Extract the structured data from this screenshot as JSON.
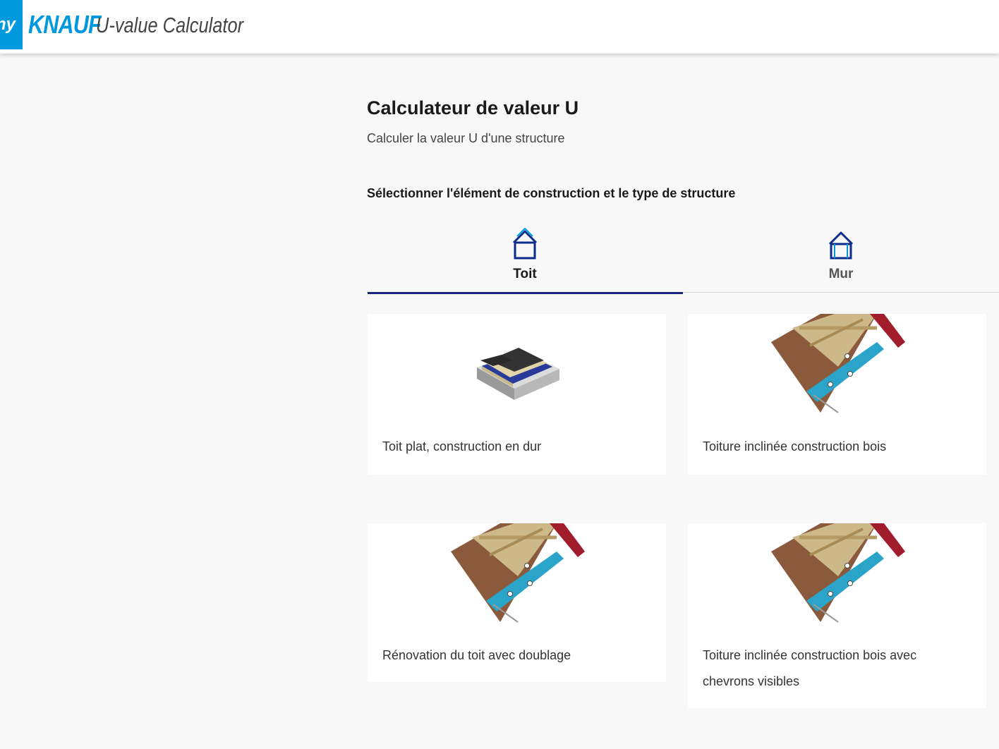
{
  "header": {
    "badge_text": "ny",
    "brand": "KNAUF",
    "app_title": "U-value Calculator"
  },
  "page": {
    "title": "Calculateur de valeur U",
    "subtitle": "Calculer la valeur U d'une structure",
    "section_label": "Sélectionner l'élément de construction et le type de structure"
  },
  "tabs": [
    {
      "label": "Toit",
      "icon": "roof-house-icon",
      "active": true
    },
    {
      "label": "Mur",
      "icon": "wall-house-icon",
      "active": false
    }
  ],
  "cards": [
    {
      "label": "Toit plat, construction en dur",
      "image": "flat-roof-image"
    },
    {
      "label": "Toiture inclinée construction bois",
      "image": "pitched-roof-image"
    },
    {
      "label": "Rénovation du toit avec doublage",
      "image": "roof-renovation-image"
    },
    {
      "label": "Toiture inclinée construction bois avec chevrons visibles",
      "image": "pitched-roof-visible-rafters-image"
    }
  ],
  "colors": {
    "brand_blue": "#0099dd",
    "active_tab_underline": "#1a237e",
    "icon_blue": "#0d2c8c"
  }
}
